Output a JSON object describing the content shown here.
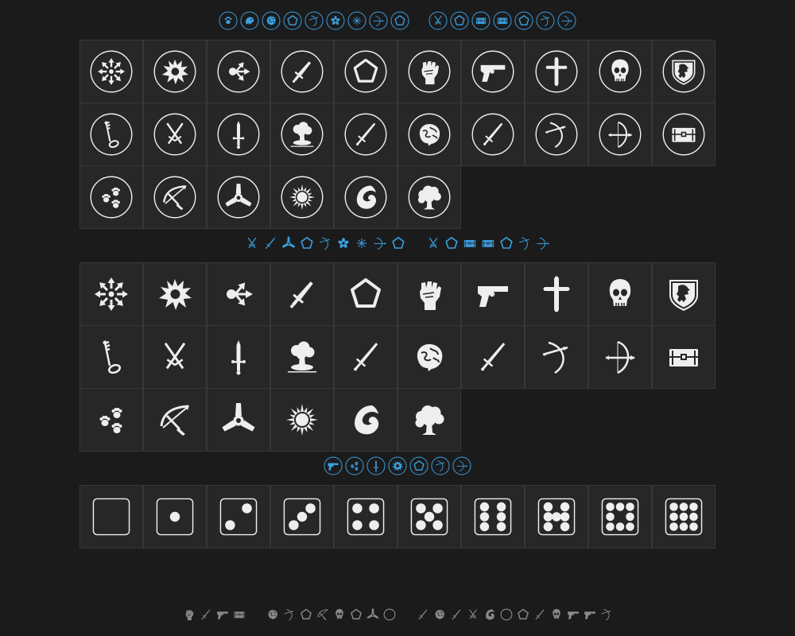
{
  "colors": {
    "background": "#1b1b1c",
    "cell": "#272727",
    "cell_border": "#383838",
    "icon": "#eeeeee",
    "accent": "#3aa0e0",
    "muted": "#8a8a8a"
  },
  "top_strip": [
    "paw-icon",
    "dragon-icon",
    "brain-icon",
    "pentagon-icon",
    "bow-icon",
    "flower-icon",
    "spark-icon",
    "crosshair-icon",
    "pentagon-icon",
    "gap",
    "crossed-swords-icon",
    "pentagon-icon",
    "chest-icon",
    "chest-icon",
    "pentagon-icon",
    "bow-icon",
    "crosshair-icon"
  ],
  "grid1": [
    "chaos-icon",
    "explosion-icon",
    "split-arrows-icon",
    "dagger-icon",
    "pentagon-icon",
    "fist-icon",
    "pistol-icon",
    "cross-icon",
    "skull-icon",
    "lion-shield-icon",
    "key-icon",
    "crossed-swords-icon",
    "stiletto-icon",
    "mushroom-cloud-icon",
    "sword-icon",
    "brain-icon",
    "sword-icon",
    "bow-icon",
    "bow-arrow-icon",
    "chest-icon",
    "paws-icon",
    "crossbow-icon",
    "triskele-icon",
    "sun-icon",
    "fire-icon",
    "tree-icon"
  ],
  "mid_strip": [
    "crossed-swords-icon",
    "sword-icon",
    "triskele-icon",
    "pentagon-icon",
    "bow-icon",
    "flower-icon",
    "spark-icon",
    "crosshair-icon",
    "pentagon-icon",
    "gap",
    "crossed-swords-icon",
    "pentagon-icon",
    "chest-icon",
    "chest-icon",
    "pentagon-icon",
    "bow-icon",
    "crosshair-icon"
  ],
  "grid2": [
    "chaos-icon",
    "explosion-icon",
    "split-arrows-icon",
    "dagger-icon",
    "pentagon-icon",
    "fist-icon",
    "pistol-icon",
    "cross-icon",
    "skull-icon",
    "lion-shield-icon",
    "key-icon",
    "crossed-swords-icon",
    "stiletto-icon",
    "mushroom-cloud-icon",
    "sword-icon",
    "brain-icon",
    "sword-icon",
    "bow-icon",
    "bow-arrow-icon",
    "chest-icon",
    "paws-icon",
    "crossbow-icon",
    "triskele-icon",
    "sun-icon",
    "fire-icon",
    "tree-icon"
  ],
  "strip3": [
    "pistol-icon",
    "paws-icon",
    "stiletto-icon",
    "explosion-icon",
    "pentagon-icon",
    "bow-icon",
    "crosshair-icon"
  ],
  "dice": [
    0,
    1,
    2,
    3,
    4,
    5,
    6,
    7,
    8,
    9
  ],
  "bottom_strip": [
    "fist-icon",
    "sword-icon",
    "pistol-icon",
    "chest-icon",
    "gap",
    "brain-icon",
    "bow-icon",
    "pentagon-icon",
    "crossbow-icon",
    "skull-icon",
    "pentagon-icon",
    "triskele-icon",
    "circle-icon",
    "gap",
    "sword-icon",
    "brain-icon",
    "sword-icon",
    "crossed-swords-icon",
    "fire-icon",
    "circle-icon",
    "pentagon-icon",
    "sword-icon",
    "skull-icon",
    "pistol-icon",
    "pistol-icon",
    "bow-icon"
  ]
}
